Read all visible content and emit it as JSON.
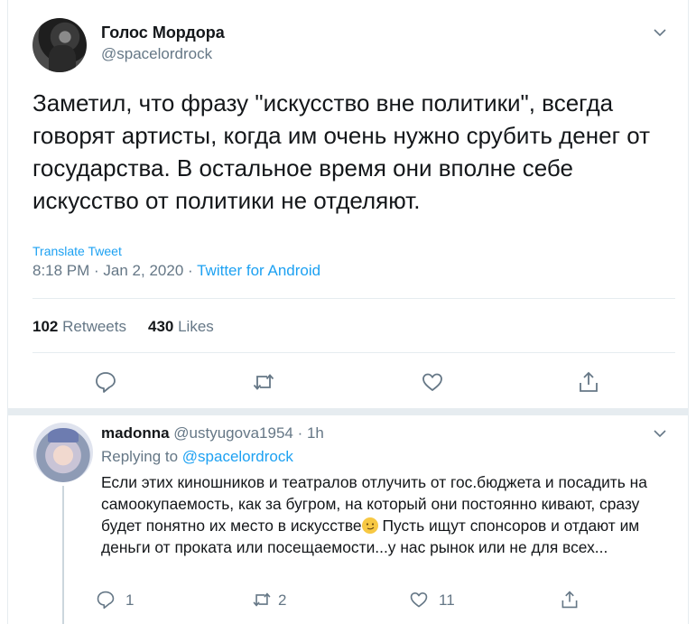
{
  "tweet": {
    "author_name": "Голос Мордора",
    "author_handle": "@spacelordrock",
    "text": "Заметил, что фразу \"искусство вне политики\", всегда говорят артисты, когда им очень нужно срубить денег от государства. В остальное время они вполне себе искусство от политики не отделяют.",
    "translate_label": "Translate Tweet",
    "timestamp": "8:18 PM · Jan 2, 2020",
    "dot": " · ",
    "source": "Twitter for Android",
    "retweets_count": "102",
    "retweets_label": "Retweets",
    "likes_count": "430",
    "likes_label": "Likes"
  },
  "icons": {
    "reply": "reply-icon",
    "retweet": "retweet-icon",
    "like": "heart-icon",
    "share": "share-icon",
    "more": "chevron-down-icon"
  },
  "reply": {
    "author_name": "madonna",
    "author_handle": "@ustyugova1954",
    "time": " · 1h",
    "replying_prefix": "Replying to ",
    "replying_to": "@spacelordrock",
    "text_part1": "Если этих киношников и театралов отлучить от гос.бюджета и посадить на самоокупаемость, как за бугром, на который они постоянно кивают, сразу будет понятно их место в искусстве",
    "text_part2": " Пусть ищут спонсоров и отдают им деньги от проката или посещаемости...у нас рынок или не для всех...",
    "reply_count": "1",
    "retweet_count": "2",
    "like_count": "11"
  },
  "colors": {
    "accent": "#1da1f2",
    "secondary_text": "#657786",
    "divider": "#e6ecf0"
  }
}
